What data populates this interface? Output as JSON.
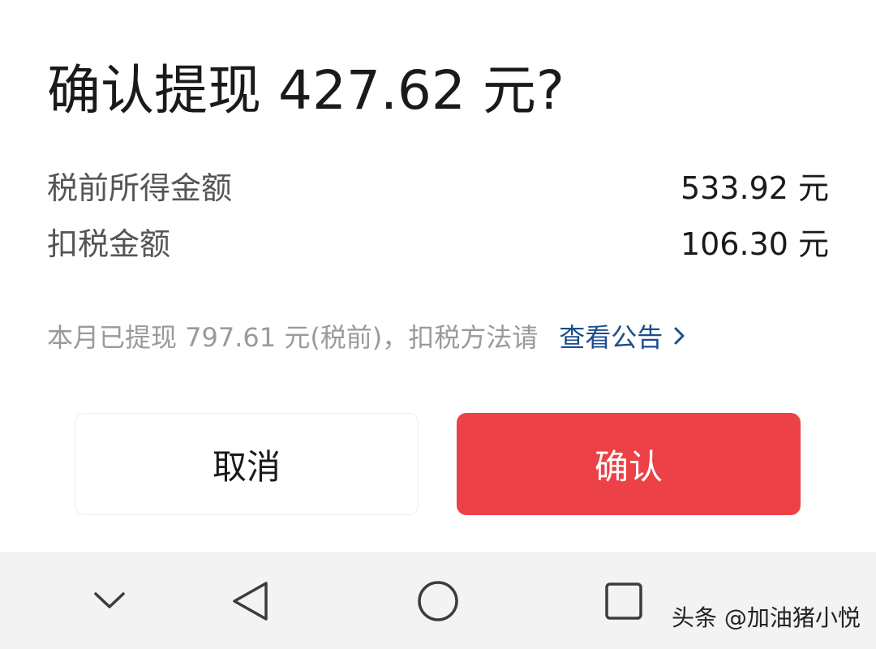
{
  "dialog": {
    "title": "确认提现 427.62 元?",
    "rows": [
      {
        "label": "税前所得金额",
        "value": "533.92 元"
      },
      {
        "label": "扣税金额",
        "value": "106.30 元"
      }
    ],
    "notice_text": "本月已提现 797.61 元(税前)，扣税方法请",
    "notice_link": "查看公告",
    "cancel_label": "取消",
    "confirm_label": "确认"
  },
  "navbar": {
    "icons": [
      "chevron-down-icon",
      "back-triangle-icon",
      "home-circle-icon",
      "recents-square-icon"
    ]
  },
  "watermark": "头条 @加油猪小悦",
  "colors": {
    "confirm_button": "#ec4146",
    "link": "#1a4d8c",
    "navbar_bg": "#f3f3f3"
  }
}
